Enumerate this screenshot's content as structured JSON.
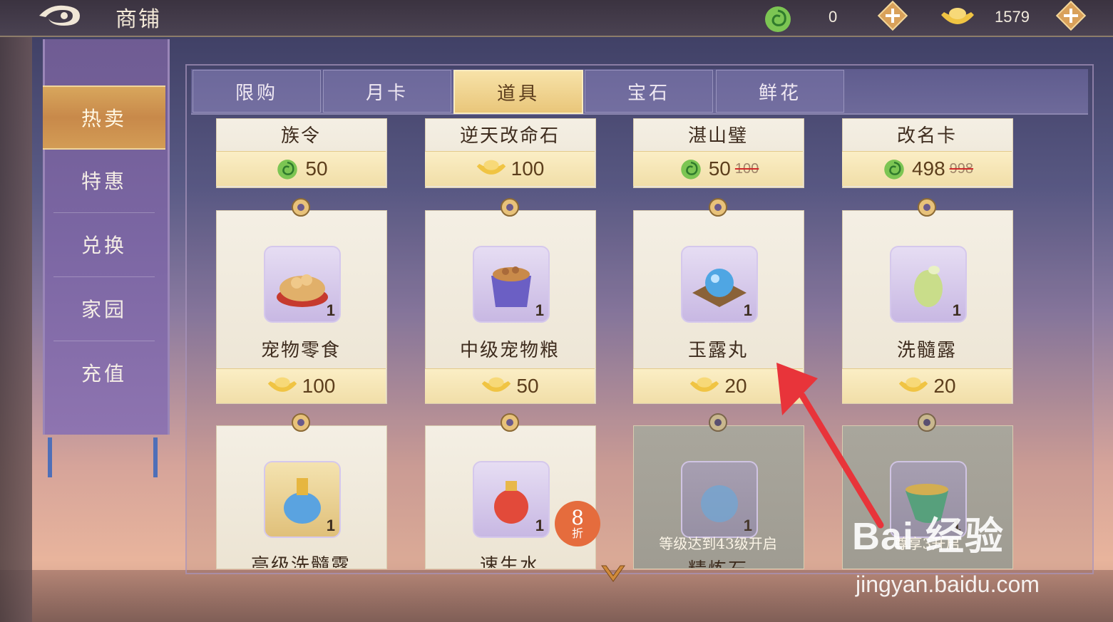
{
  "header": {
    "title": "商铺",
    "jade_amount": "0",
    "gold_amount": "1579"
  },
  "sidebar": {
    "items": [
      {
        "label": "热卖",
        "active": true
      },
      {
        "label": "特惠",
        "active": false
      },
      {
        "label": "兑换",
        "active": false
      },
      {
        "label": "家园",
        "active": false
      },
      {
        "label": "充值",
        "active": false
      }
    ]
  },
  "tabs": [
    {
      "label": "限购",
      "active": false
    },
    {
      "label": "月卡",
      "active": false
    },
    {
      "label": "道具",
      "active": true
    },
    {
      "label": "宝石",
      "active": false
    },
    {
      "label": "鲜花",
      "active": false
    }
  ],
  "items_row1": [
    {
      "name": "族令",
      "currency": "jade",
      "price": "50",
      "old_price": ""
    },
    {
      "name": "逆天改命石",
      "currency": "gold",
      "price": "100",
      "old_price": ""
    },
    {
      "name": "湛山璧",
      "currency": "jade",
      "price": "50",
      "old_price": "100"
    },
    {
      "name": "改名卡",
      "currency": "jade",
      "price": "498",
      "old_price": "998"
    }
  ],
  "items_row2": [
    {
      "name": "宠物零食",
      "currency": "gold",
      "price": "100",
      "qty": "1",
      "icon": "pet-snack-icon"
    },
    {
      "name": "中级宠物粮",
      "currency": "gold",
      "price": "50",
      "qty": "1",
      "icon": "pet-food-bag-icon"
    },
    {
      "name": "玉露丸",
      "currency": "gold",
      "price": "20",
      "qty": "1",
      "icon": "jade-pill-icon"
    },
    {
      "name": "洗髓露",
      "currency": "gold",
      "price": "20",
      "qty": "1",
      "icon": "marrow-dew-icon"
    }
  ],
  "items_row3": [
    {
      "name": "高级洗髓露",
      "qty": "1",
      "icon": "bottle-icon"
    },
    {
      "name": "速生水",
      "qty": "1",
      "icon": "potion-icon",
      "discount": "8",
      "discount_unit": "折"
    },
    {
      "name": "精炼石",
      "qty": "1",
      "icon": "refine-stone-icon",
      "locked_text": "等级达到43级开启"
    },
    {
      "name": "",
      "qty": "1",
      "icon": "horn-icon",
      "locked_text": "尊享3开启"
    }
  ],
  "watermark": {
    "brand": "Bai 经验",
    "url": "jingyan.baidu.com"
  },
  "colors": {
    "accent": "#e9c67a",
    "red_arrow": "#e8343a",
    "discount": "#e56c3d"
  }
}
